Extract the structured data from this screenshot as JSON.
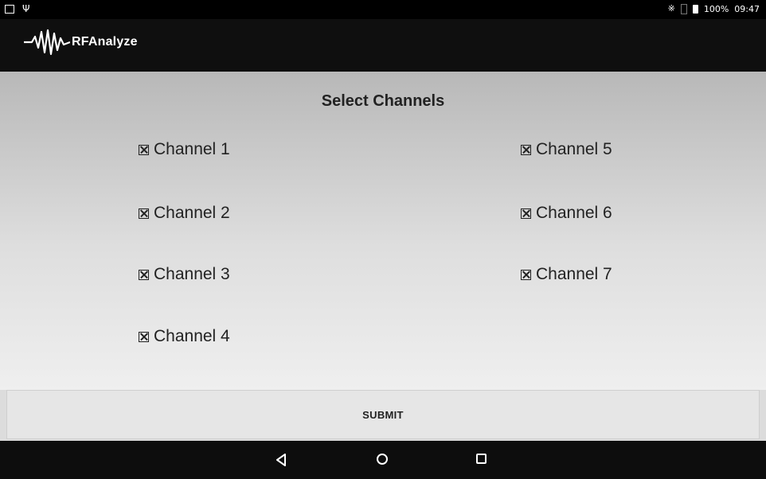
{
  "status_bar": {
    "battery": "100%",
    "time": "09:47"
  },
  "app_bar": {
    "title": "RFAnalyze"
  },
  "main": {
    "title": "Select Channels",
    "channels": [
      {
        "label": "Channel 1",
        "checked": true
      },
      {
        "label": "Channel 2",
        "checked": true
      },
      {
        "label": "Channel 3",
        "checked": true
      },
      {
        "label": "Channel 4",
        "checked": true
      },
      {
        "label": "Channel 5",
        "checked": true
      },
      {
        "label": "Channel 6",
        "checked": true
      },
      {
        "label": "Channel 7",
        "checked": true
      }
    ],
    "submit_label": "SUBMIT"
  },
  "icons": {
    "status_left": [
      "image-icon",
      "usb-icon"
    ],
    "status_right": [
      "bluetooth-icon",
      "signal-icon",
      "battery-icon"
    ],
    "nav": [
      "back-icon",
      "home-icon",
      "recents-icon"
    ]
  }
}
